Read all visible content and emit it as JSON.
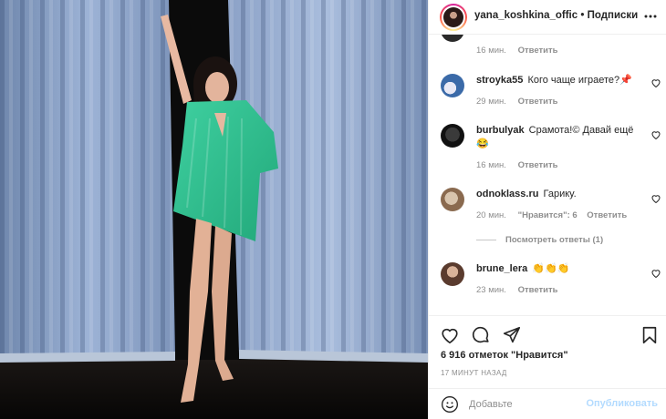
{
  "post": {
    "photo_alt": "photo"
  },
  "header": {
    "username": "yana_koshkina_offic",
    "separator": "•",
    "follow_label": "Подписки",
    "more_icon": "more-dots-icon"
  },
  "top_comment_meta": {
    "time": "16 мин.",
    "reply_label": "Ответить"
  },
  "comments": [
    {
      "username": "stroyka55",
      "text": "Кого чаще играете?📌",
      "time": "29 мин.",
      "likes_label": "",
      "reply_label": "Ответить",
      "avatar_color": "#3b6aa8"
    },
    {
      "username": "burbulyak",
      "text": "Срамота!© Давай ещё 😂",
      "time": "16 мин.",
      "likes_label": "",
      "reply_label": "Ответить",
      "avatar_color": "#1d1d1d"
    },
    {
      "username": "odnoklass.ru",
      "text": "Гарику.",
      "time": "20 мин.",
      "likes_label": "\"Нравится\": 6",
      "reply_label": "Ответить",
      "avatar_color": "#8a6a4f"
    },
    {
      "username": "brune_lera",
      "text": "👏👏👏",
      "time": "23 мин.",
      "likes_label": "",
      "reply_label": "Ответить",
      "avatar_color": "#5a3b2e"
    }
  ],
  "view_replies_label": "Посмотреть ответы (1)",
  "actions": {
    "likes_count": "6 916 отметок \"Нравится\"",
    "posted_time": "17 МИНУТ НАЗАД"
  },
  "add_comment": {
    "placeholder": "Добавьте",
    "publish_label": "Опубликовать"
  }
}
